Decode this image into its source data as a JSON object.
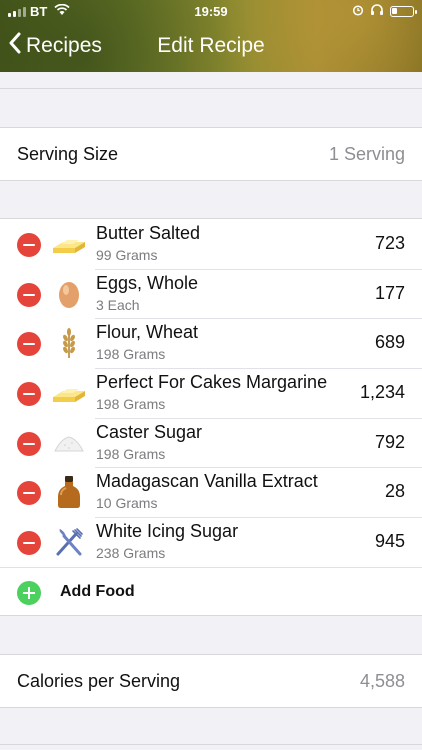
{
  "status_bar": {
    "carrier": "BT",
    "time": "19:59"
  },
  "nav": {
    "back_label": "Recipes",
    "title": "Edit Recipe"
  },
  "serving": {
    "label": "Serving Size",
    "value": "1 Serving"
  },
  "ingredients": [
    {
      "name": "Butter Salted",
      "quantity": "99 Grams",
      "calories": "723",
      "icon": "butter-icon"
    },
    {
      "name": "Eggs, Whole",
      "quantity": "3 Each",
      "calories": "177",
      "icon": "egg-icon"
    },
    {
      "name": "Flour, Wheat",
      "quantity": "198 Grams",
      "calories": "689",
      "icon": "wheat-icon"
    },
    {
      "name": "Perfect For Cakes Margarine",
      "quantity": "198 Grams",
      "calories": "1,234",
      "icon": "butter-icon"
    },
    {
      "name": "Caster Sugar",
      "quantity": "198 Grams",
      "calories": "792",
      "icon": "sugar-icon"
    },
    {
      "name": "Madagascan Vanilla Extract",
      "quantity": "10 Grams",
      "calories": "28",
      "icon": "bottle-icon"
    },
    {
      "name": "White Icing Sugar",
      "quantity": "238 Grams",
      "calories": "945",
      "icon": "fork-knife-icon"
    }
  ],
  "add_food": {
    "label": "Add Food"
  },
  "calories_per_serving": {
    "label": "Calories per Serving",
    "value": "4,588"
  },
  "colors": {
    "delete": "#e5443a",
    "add": "#4cd05e",
    "secondary_text": "#8e8e93"
  }
}
